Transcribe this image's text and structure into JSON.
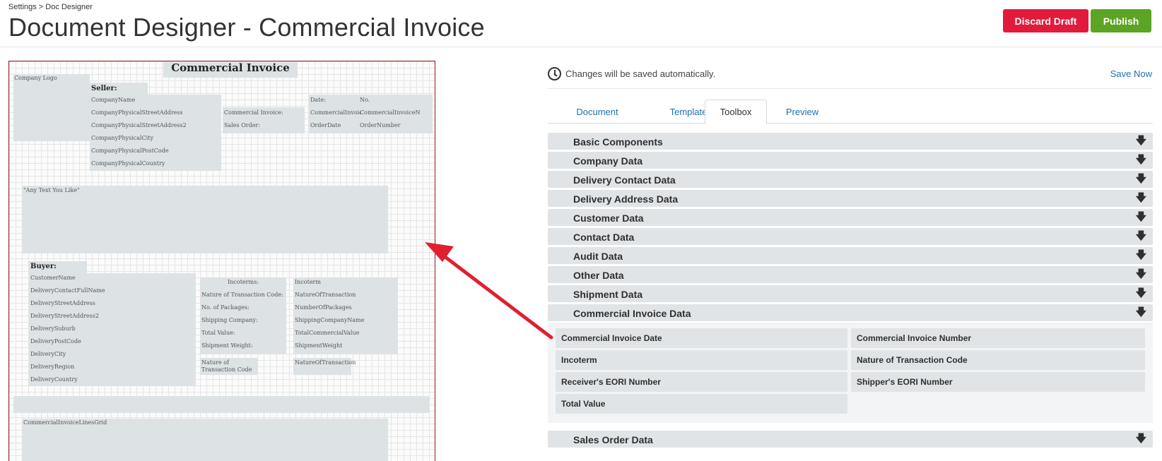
{
  "breadcrumb": "Settings > Doc Designer",
  "page_title": "Document Designer - Commercial Invoice",
  "actions": {
    "discard": "Discard Draft",
    "publish": "Publish"
  },
  "colors": {
    "discard": "#e21b3c",
    "publish": "#5ba424",
    "link": "#1f6fae",
    "canvas_border": "#8b1a1a",
    "annotation_arrow": "#e0202e"
  },
  "canvas": {
    "title": "Commercial Invoice",
    "company_logo": "Company Logo",
    "seller_heading": "Seller:",
    "seller_fields": [
      "CompanyName",
      "CompanyPhysicalStreetAddress",
      "CompanyPhysicalStreetAddress2",
      "CompanyPhysicalCity",
      "CompanyPhysicalPostCode",
      "CompanyPhysicalCountry"
    ],
    "ci_label": "Commercial Invoice:",
    "so_label": "Sales Order:",
    "date_label": "Date:",
    "no_label": "No.",
    "ci_date_field": "CommercialInvoiceDate",
    "ci_number_field": "CommercialInvoiceNumber",
    "order_date_field": "OrderDate",
    "order_number_field": "OrderNumber",
    "free_text": "\"Any Text You Like\"",
    "buyer_heading": "Buyer:",
    "buyer_fields": [
      "CustomerName",
      "DeliveryContactFullName",
      "DeliveryStreetAddress",
      "DeliveryStreetAddress2",
      "DeliverySuburb",
      "DeliveryPostCode",
      "DeliveryCity",
      "DeliveryRegion",
      "DeliveryCountry"
    ],
    "incoterms_heading": "Incoterms:",
    "shipping_labels": [
      "Nature of Transaction Code:",
      "No. of Packages:",
      "Shipping Company:",
      "Total Value:",
      "Shipment Weight:"
    ],
    "incoterm_field": "Incoterm",
    "shipping_fields": [
      "NatureOfTransaction",
      "NumberOfPackages",
      "ShippingCompanyName",
      "TotalCommercialValue",
      "ShipmentWeight"
    ],
    "ntc_label2": "Nature of Transaction Code",
    "ntc_field2": "NatureOfTransaction",
    "lines_grid": "CommercialInvoiceLinesGrid"
  },
  "panel": {
    "autosave_text": "Changes will be saved automatically.",
    "save_now": "Save Now",
    "tabs": [
      "Document",
      "Template",
      "Toolbox",
      "Preview"
    ],
    "active_tab": "Toolbox",
    "sections": [
      "Basic Components",
      "Company Data",
      "Delivery Contact Data",
      "Delivery Address Data",
      "Customer Data",
      "Contact Data",
      "Audit Data",
      "Other Data",
      "Shipment Data",
      "Commercial Invoice Data"
    ],
    "expanded_items": [
      "Commercial Invoice Date",
      "Commercial Invoice Number",
      "Incoterm",
      "Nature of Transaction Code",
      "Receiver's EORI Number",
      "Shipper's EORI Number",
      "Total Value"
    ],
    "after_section": "Sales Order Data",
    "arrow_icon": "arrow-down-icon"
  }
}
